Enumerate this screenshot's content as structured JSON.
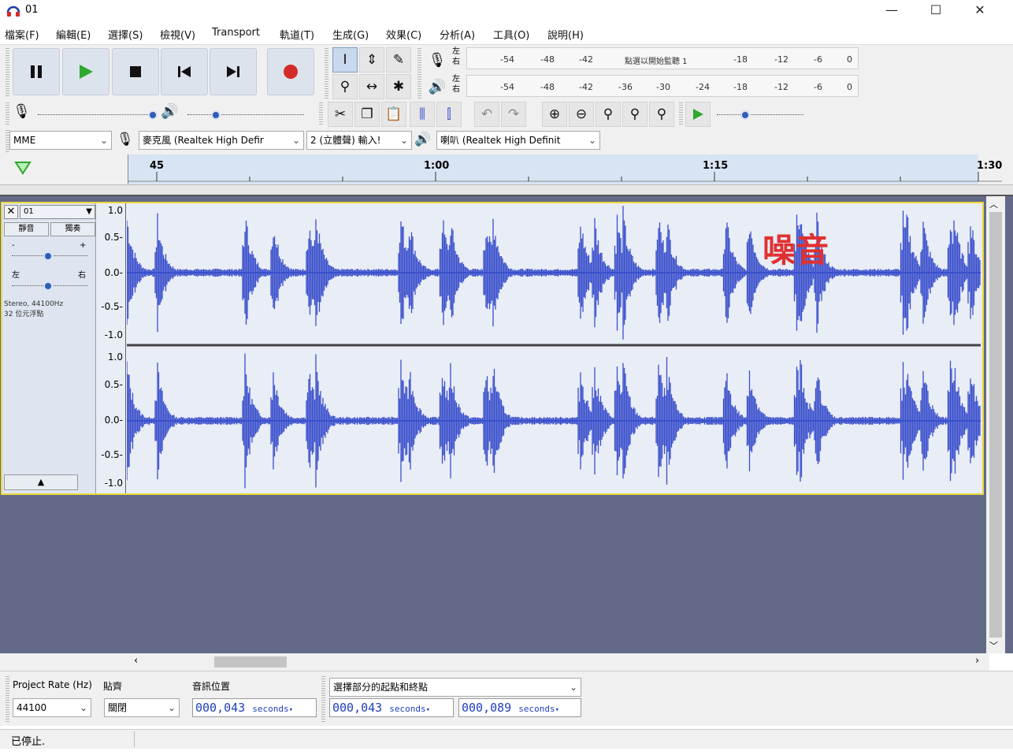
{
  "window": {
    "title": "01",
    "minimize": "—",
    "maximize": "☐",
    "close": "✕"
  },
  "menu": [
    "檔案(F)",
    "編輯(E)",
    "選擇(S)",
    "檢視(V)",
    "Transport",
    "軌道(T)",
    "生成(G)",
    "效果(C)",
    "分析(A)",
    "工具(O)",
    "說明(H)"
  ],
  "colors": {
    "waveform": "#3a4fcc",
    "record": "#d42a2a",
    "play": "#2fa82f",
    "annotation": "#e03030",
    "selection_border": "#e9d93c",
    "timecode": "#1f3fbf"
  },
  "meters": {
    "record_channels": [
      "左",
      "右"
    ],
    "record_ticks": [
      "-54",
      "-48",
      "-42",
      "-18",
      "-12",
      "-6",
      "0"
    ],
    "record_hint": "點選以開始監聽 1",
    "play_channels": [
      "左",
      "右"
    ],
    "play_ticks": [
      "-54",
      "-48",
      "-42",
      "-36",
      "-30",
      "-24",
      "-18",
      "-12",
      "-6",
      "0"
    ]
  },
  "device": {
    "host": "MME",
    "input": "麥克風 (Realtek High Defir",
    "channels": "2 (立體聲) 輸入!",
    "output": "喇叭 (Realtek High Definit"
  },
  "timeline": {
    "labels": [
      "45",
      "1:00",
      "1:15",
      "1:30"
    ]
  },
  "track": {
    "name": "01",
    "mute": "靜音",
    "solo": "獨奏",
    "gain_minus": "-",
    "gain_plus": "+",
    "pan_left": "左",
    "pan_right": "右",
    "info_line1": "Stereo, 44100Hz",
    "info_line2": "32 位元浮點",
    "collapse": "▲",
    "scale": [
      "1.0",
      "0.5-",
      "0.0-",
      "-0.5-",
      "-1.0"
    ],
    "annotation": "噪音"
  },
  "selection_toolbar": {
    "rate_label": "Project Rate (Hz)",
    "rate_value": "44100",
    "snap_label": "貼齊",
    "snap_value": "關閉",
    "pos_label": "音訊位置",
    "pos_value": "000,043",
    "sel_mode": "選擇部分的起點和終點",
    "sel_start": "000,043",
    "sel_end": "000,089",
    "unit": "seconds"
  },
  "status": {
    "text": "已停止."
  }
}
